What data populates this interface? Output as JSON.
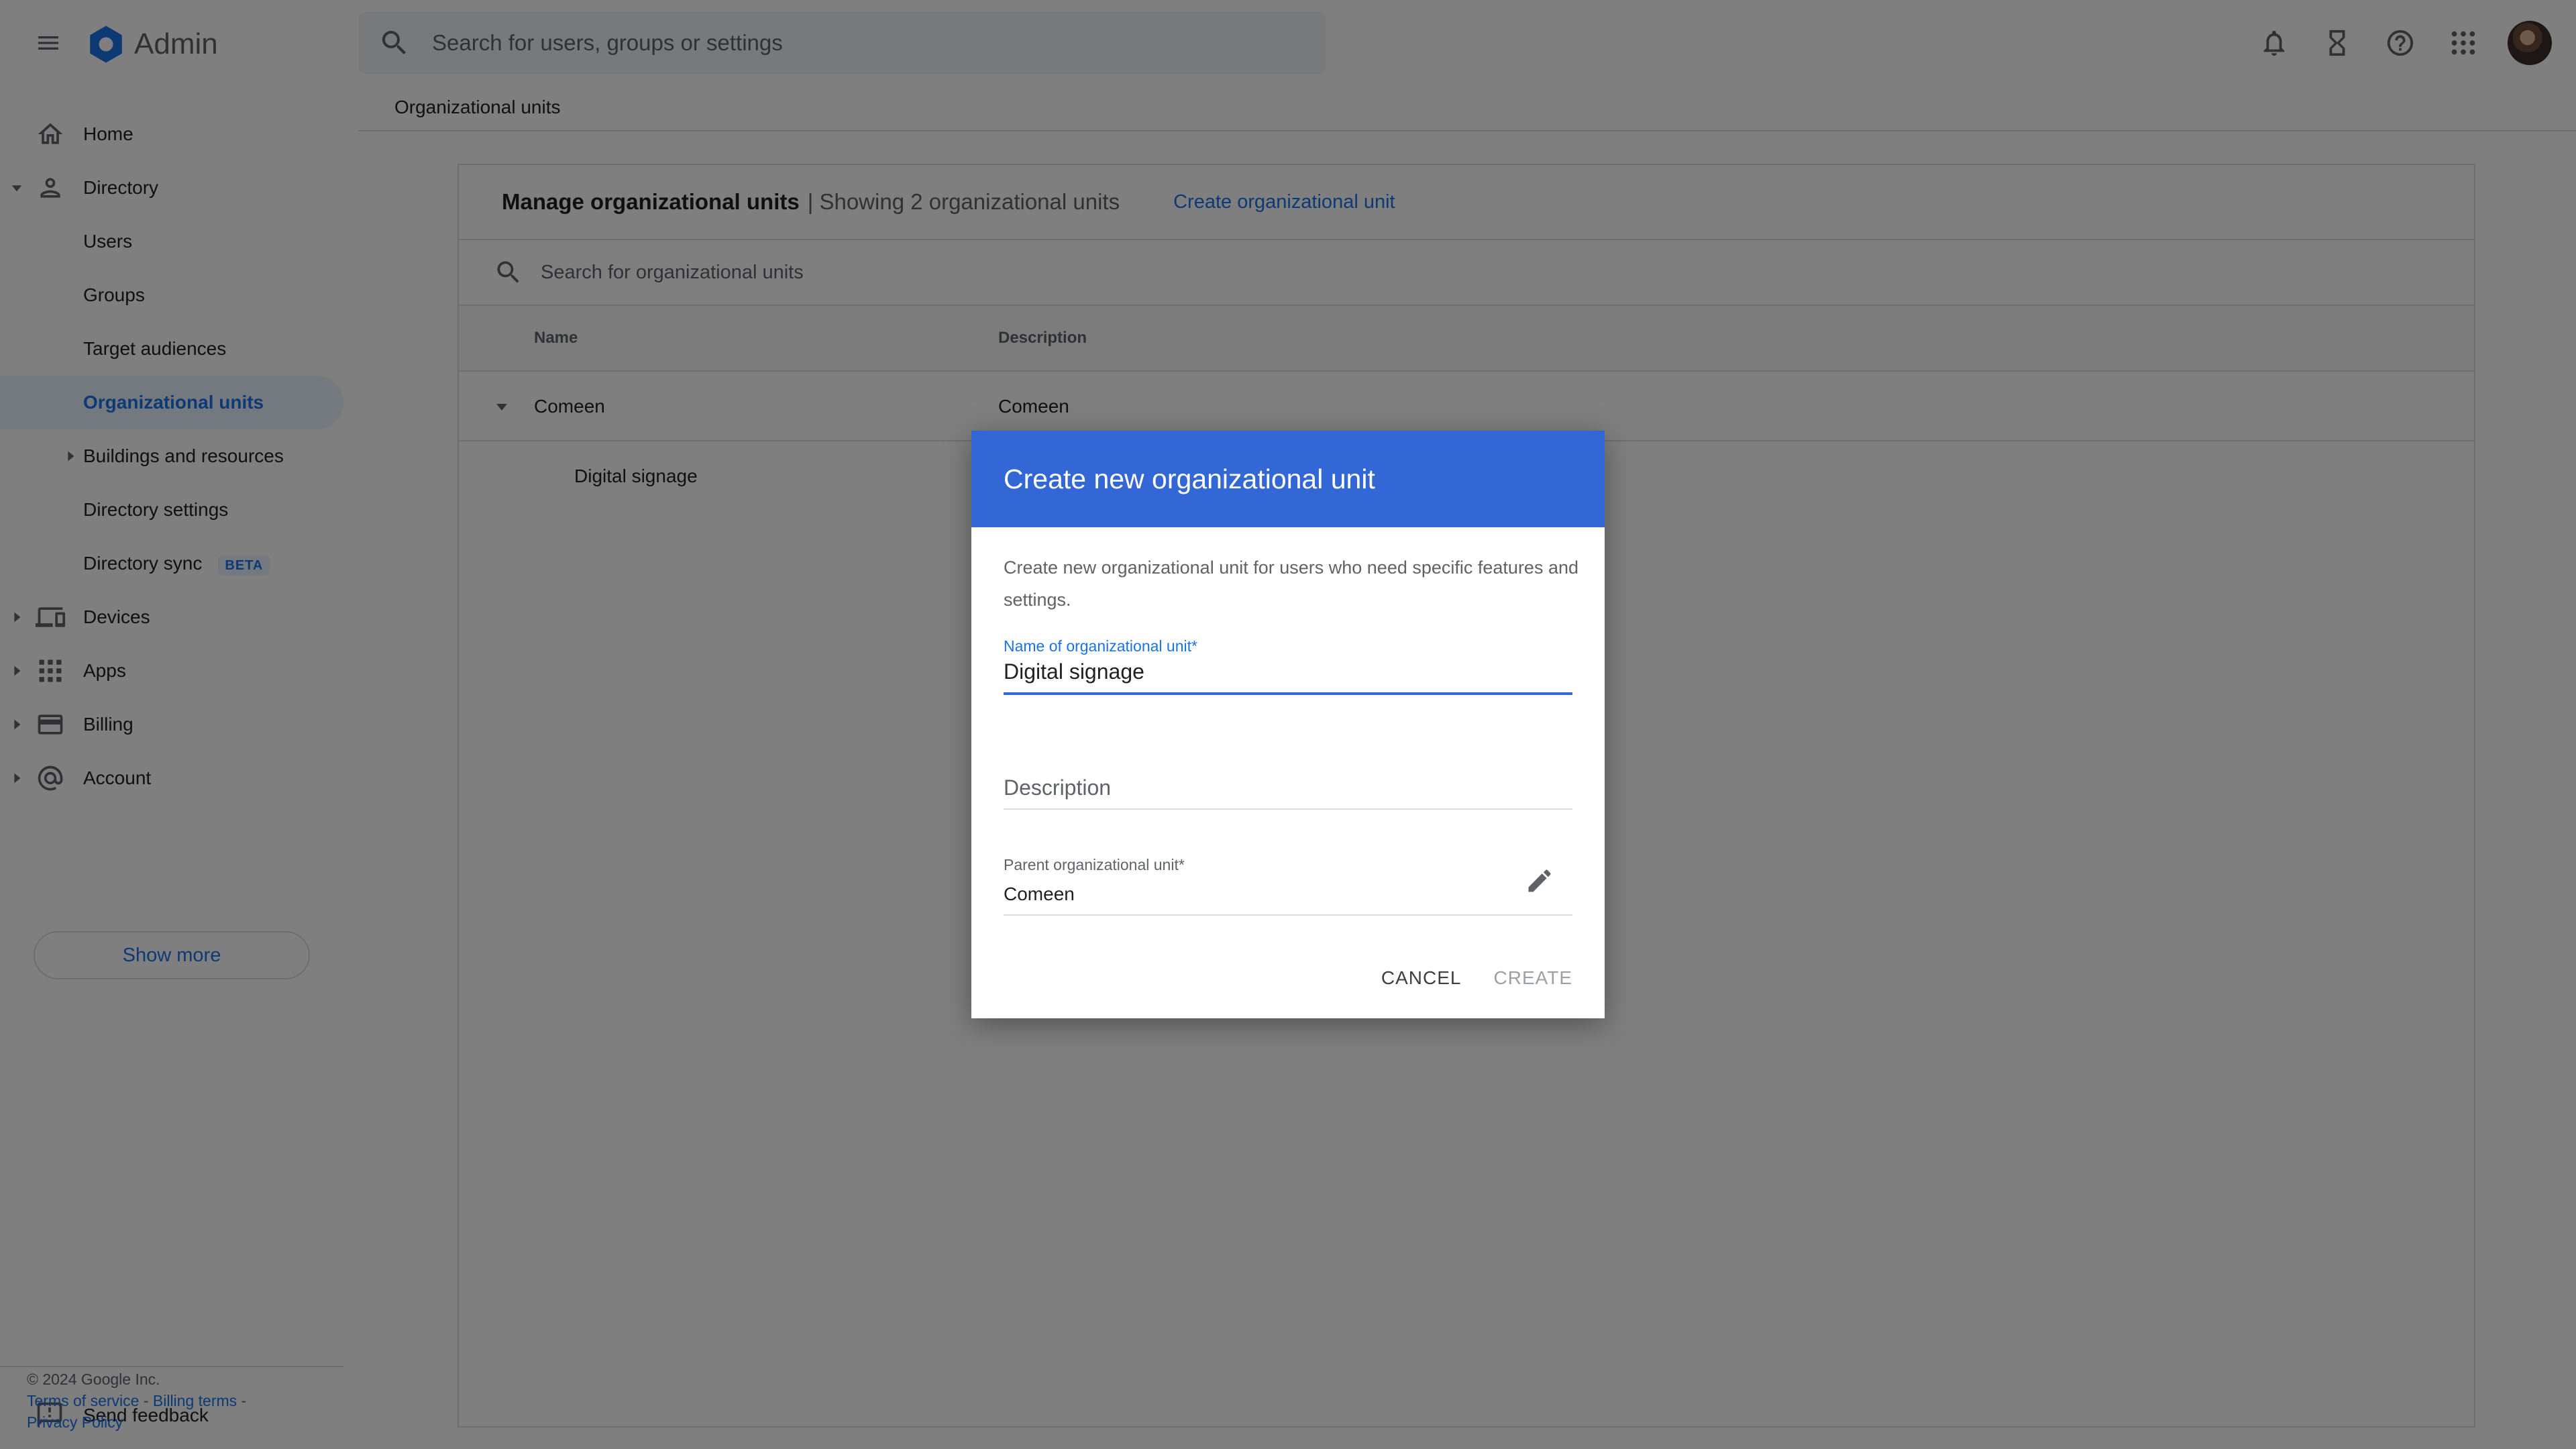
{
  "app": {
    "title": "Admin"
  },
  "search": {
    "placeholder": "Search for users, groups or settings"
  },
  "breadcrumb": "Organizational units",
  "sidebar": {
    "items": [
      {
        "label": "Home"
      },
      {
        "label": "Directory"
      },
      {
        "label": "Users"
      },
      {
        "label": "Groups"
      },
      {
        "label": "Target audiences"
      },
      {
        "label": "Organizational units"
      },
      {
        "label": "Buildings and resources"
      },
      {
        "label": "Directory settings"
      },
      {
        "label": "Directory sync",
        "badge": "BETA"
      },
      {
        "label": "Devices"
      },
      {
        "label": "Apps"
      },
      {
        "label": "Billing"
      },
      {
        "label": "Account"
      }
    ],
    "show_more": "Show more",
    "feedback": "Send feedback"
  },
  "footer": {
    "copyright": "© 2024 Google Inc.",
    "terms": "Terms of service",
    "sep": " - ",
    "billing": "Billing terms",
    "privacy": "Privacy Policy"
  },
  "card": {
    "title": "Manage organizational units",
    "subtitle": "| Showing 2 organizational units",
    "create_link": "Create organizational unit",
    "search_placeholder": "Search for organizational units",
    "columns": {
      "name": "Name",
      "description": "Description"
    },
    "rows": [
      {
        "name": "Comeen",
        "description": "Comeen"
      },
      {
        "name": "Digital signage",
        "description": ""
      }
    ]
  },
  "dialog": {
    "title": "Create new organizational unit",
    "description": "Create new organizational unit for users who need specific features and settings.",
    "name_label": "Name of organizational unit*",
    "name_value": "Digital signage",
    "description_placeholder": "Description",
    "parent_label": "Parent organizational unit*",
    "parent_value": "Comeen",
    "cancel": "CANCEL",
    "create": "CREATE"
  },
  "colors": {
    "accent": "#1a73e8",
    "dialog_header": "#3367d6",
    "overlay": "rgba(0,0,0,0.5)"
  },
  "icons": [
    "menu-icon",
    "admin-logo-icon",
    "search-icon",
    "bell-icon",
    "hourglass-icon",
    "help-icon",
    "apps-grid-icon",
    "home-icon",
    "person-icon",
    "devices-icon",
    "apps-icon",
    "billing-card-icon",
    "at-sign-icon",
    "feedback-icon",
    "pencil-icon",
    "caret-icon"
  ]
}
